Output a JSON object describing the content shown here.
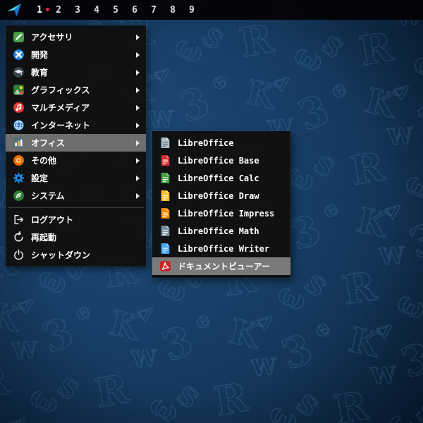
{
  "topbar": {
    "logo": "paper-plane",
    "workspaces": [
      "1",
      "2",
      "3",
      "4",
      "5",
      "6",
      "7",
      "8",
      "9"
    ],
    "active_workspace": "1"
  },
  "menu": {
    "categories": [
      {
        "label": "アクセサリ",
        "icon": "accessories-icon",
        "has_submenu": true
      },
      {
        "label": "開発",
        "icon": "development-icon",
        "has_submenu": true
      },
      {
        "label": "教育",
        "icon": "education-icon",
        "has_submenu": true
      },
      {
        "label": "グラフィックス",
        "icon": "graphics-icon",
        "has_submenu": true
      },
      {
        "label": "マルチメディア",
        "icon": "multimedia-icon",
        "has_submenu": true
      },
      {
        "label": "インターネット",
        "icon": "internet-icon",
        "has_submenu": true
      },
      {
        "label": "オフィス",
        "icon": "office-icon",
        "has_submenu": true,
        "selected": true
      },
      {
        "label": "その他",
        "icon": "other-icon",
        "has_submenu": true
      },
      {
        "label": "設定",
        "icon": "settings-icon",
        "has_submenu": true
      },
      {
        "label": "システム",
        "icon": "system-icon",
        "has_submenu": true
      }
    ],
    "actions": [
      {
        "label": "ログアウト",
        "icon": "logout-icon"
      },
      {
        "label": "再起動",
        "icon": "reboot-icon"
      },
      {
        "label": "シャットダウン",
        "icon": "shutdown-icon"
      }
    ]
  },
  "submenu": {
    "items": [
      {
        "label": "LibreOffice",
        "icon": "libreoffice-icon",
        "color": "#b0bec5"
      },
      {
        "label": "LibreOffice Base",
        "icon": "libreoffice-base-icon",
        "color": "#d32f2f"
      },
      {
        "label": "LibreOffice Calc",
        "icon": "libreoffice-calc-icon",
        "color": "#43a047"
      },
      {
        "label": "LibreOffice Draw",
        "icon": "libreoffice-draw-icon",
        "color": "#fbc02d"
      },
      {
        "label": "LibreOffice Impress",
        "icon": "libreoffice-impress-icon",
        "color": "#fb8c00"
      },
      {
        "label": "LibreOffice Math",
        "icon": "libreoffice-math-icon",
        "color": "#78909c"
      },
      {
        "label": "LibreOffice Writer",
        "icon": "libreoffice-writer-icon",
        "color": "#42a5f5"
      },
      {
        "label": "ドキュメントビューアー",
        "icon": "document-viewer-icon",
        "color": "#c62828",
        "selected": true
      }
    ]
  },
  "colors": {
    "active_workspace_dot": "#ff1744",
    "menu_background": "#0f0f10",
    "menu_highlight": "#6e6e6e",
    "desktop_blue": "#15406b"
  }
}
